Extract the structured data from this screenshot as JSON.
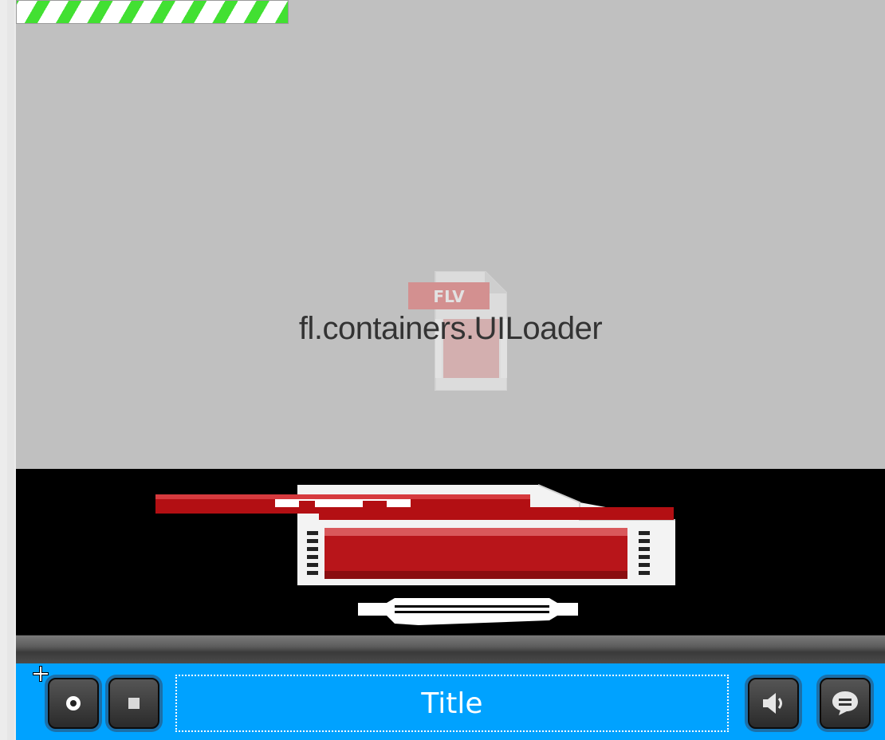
{
  "loader": {
    "label": "fl.containers.UILoader",
    "file_badge": "FLV"
  },
  "controls": {
    "title": "Title",
    "play_icon": "record-dot-icon",
    "stop_icon": "stop-square-icon",
    "volume_icon": "speaker-icon",
    "caption_icon": "speech-bubble-icon"
  },
  "colors": {
    "control_bar": "#00a2ff",
    "progress_stripe": "#42e032",
    "loader_bg": "#c0c0c0",
    "flv_red": "#c0171c"
  }
}
